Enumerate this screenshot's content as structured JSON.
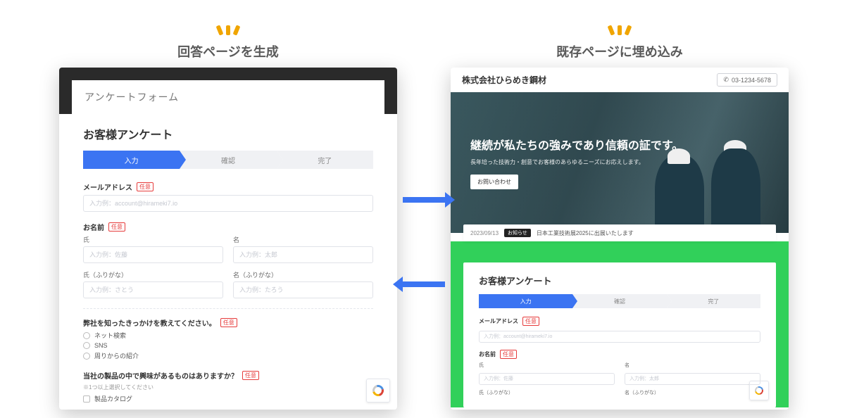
{
  "left": {
    "title": "回答ページを生成",
    "form_header": "アンケートフォーム",
    "survey_title": "お客様アンケート",
    "steps": [
      "入力",
      "確認",
      "完了"
    ],
    "email": {
      "label": "メールアドレス",
      "required": "任意",
      "placeholder": "入力例：account@hirameki7.io"
    },
    "name": {
      "label": "お名前",
      "required": "任意",
      "sei": {
        "label": "氏",
        "placeholder": "入力例：佐藤"
      },
      "mei": {
        "label": "名",
        "placeholder": "入力例：太郎"
      },
      "sei_kana": {
        "label": "氏（ふりがな）",
        "placeholder": "入力例：さとう"
      },
      "mei_kana": {
        "label": "名（ふりがな）",
        "placeholder": "入力例：たろう"
      }
    },
    "q1": {
      "label": "弊社を知ったきっかけを教えてください。",
      "required": "任意",
      "options": [
        "ネット検索",
        "SNS",
        "周りからの紹介"
      ]
    },
    "q2": {
      "label": "当社の製品の中で興味があるものはありますか？",
      "required": "任意",
      "hint": "※1つ以上選択してください",
      "options": [
        "製品カタログ"
      ]
    }
  },
  "right": {
    "title": "既存ページに埋め込み",
    "site_name": "株式会社ひらめき鋼材",
    "phone": "03-1234-5678",
    "hero_title": "継続が私たちの強みであり信頼の証です。",
    "hero_sub": "長年培った技術力・創意でお客様のあらゆるニーズにお応えします。",
    "hero_button": "お問い合わせ",
    "news": {
      "date": "2023/09/13",
      "tag": "お知らせ",
      "text": "日本工業技術展2025に出展いたします"
    },
    "survey_title": "お客様アンケート",
    "steps": [
      "入力",
      "確認",
      "完了"
    ],
    "email": {
      "label": "メールアドレス",
      "required": "任意",
      "placeholder": "入力例：account@hirameki7.io"
    },
    "name": {
      "label": "お名前",
      "required": "任意",
      "sei": {
        "label": "氏",
        "placeholder": "入力例：佐藤"
      },
      "mei": {
        "label": "名",
        "placeholder": "入力例：太郎"
      },
      "sei_kana": {
        "label": "氏（ふりがな）"
      },
      "mei_kana": {
        "label": "名（ふりがな）"
      }
    }
  }
}
